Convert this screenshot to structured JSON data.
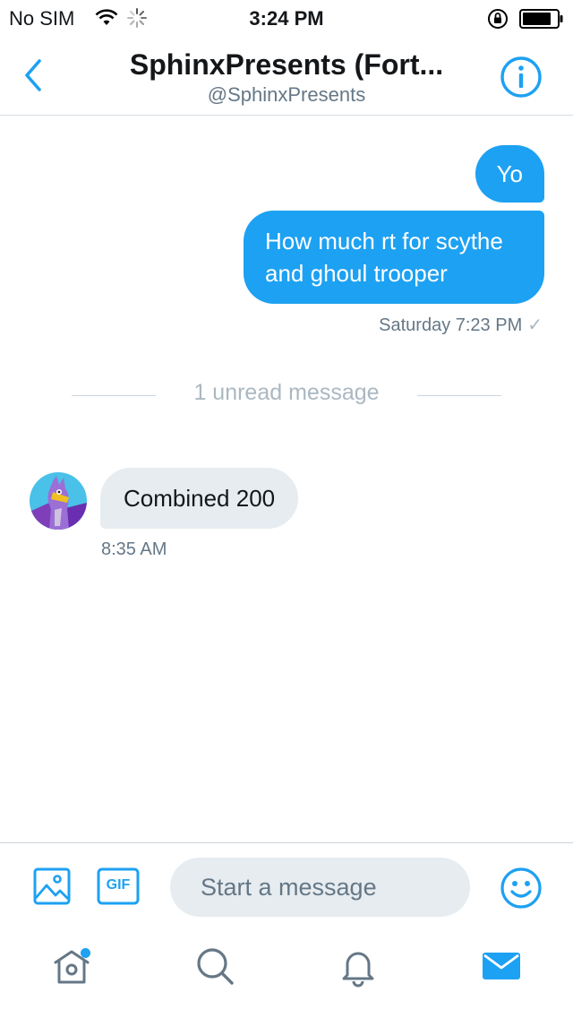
{
  "status_bar": {
    "carrier": "No SIM",
    "time": "3:24 PM",
    "icons": [
      "wifi-icon",
      "spinner-icon",
      "rotation-lock-icon",
      "battery-icon"
    ]
  },
  "header": {
    "title": "SphinxPresents (Fort...",
    "handle": "@SphinxPresents",
    "icons": [
      "back-chevron-icon",
      "info-icon"
    ]
  },
  "conversation": {
    "sent_messages": [
      {
        "text": "Yo"
      },
      {
        "text": "How much rt for scythe and ghoul trooper"
      }
    ],
    "sent_meta": "Saturday 7:23 PM",
    "sent_status_icon": "checkmark-icon",
    "divider_text": "1 unread message",
    "received_messages": [
      {
        "text": "Combined 200"
      }
    ],
    "received_meta": "8:35 AM"
  },
  "composer": {
    "placeholder": "Start a message",
    "value": "",
    "gif_label": "GIF",
    "icons": [
      "photo-icon",
      "gif-icon",
      "emoji-icon"
    ]
  },
  "tab_bar": {
    "items": [
      "home-icon",
      "search-icon",
      "notifications-icon",
      "messages-icon"
    ],
    "active": "messages-icon",
    "home_has_badge": true
  },
  "colors": {
    "accent": "#1da1f2",
    "incoming_bubble": "#e6ecf0",
    "secondary_text": "#657786",
    "divider_text": "#aab8c2",
    "inactive_icon": "#657786"
  }
}
